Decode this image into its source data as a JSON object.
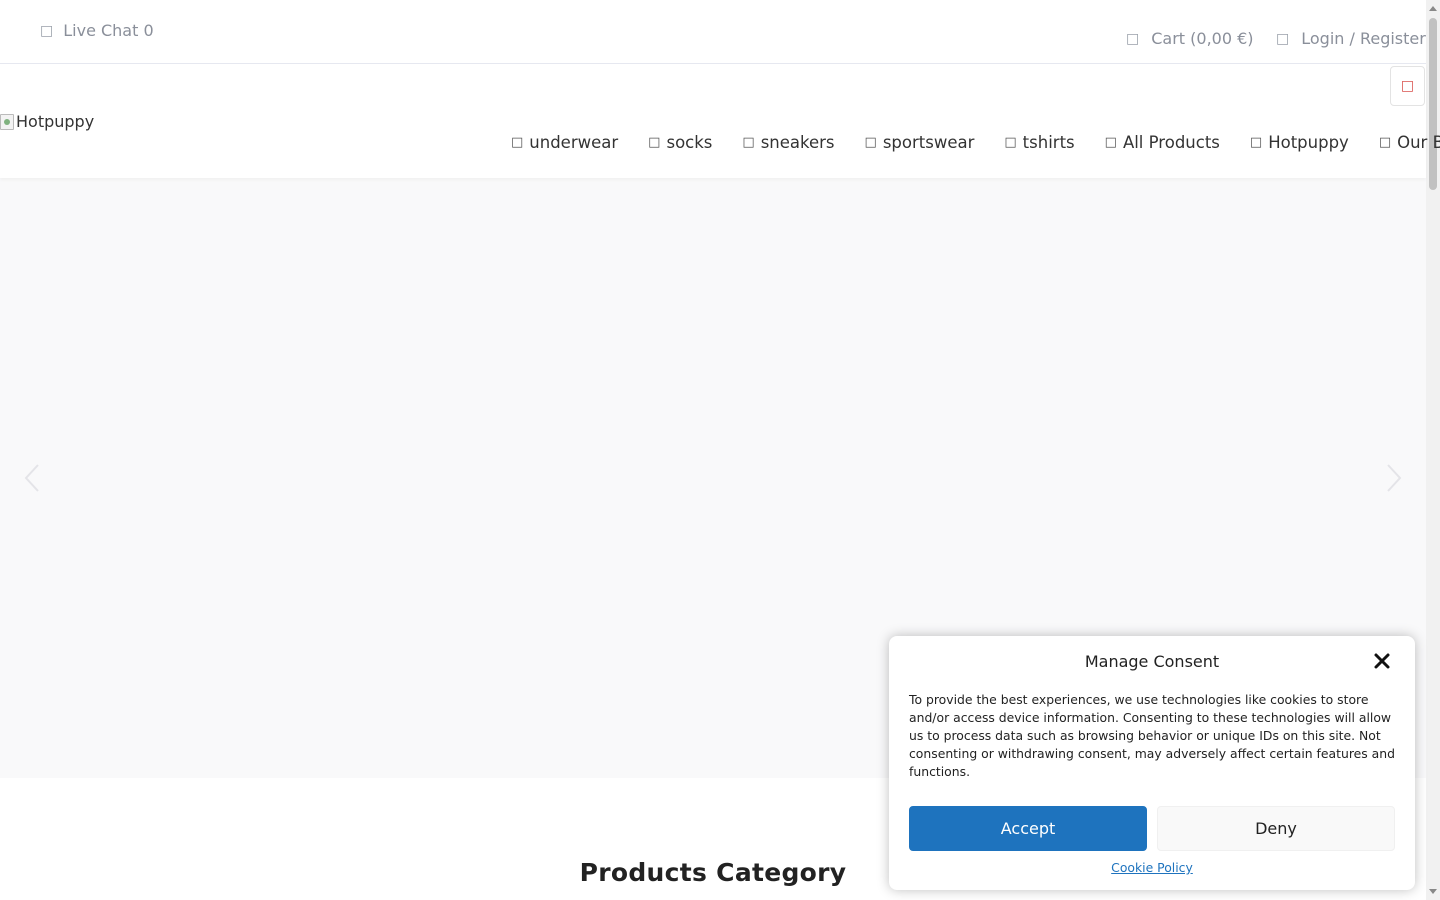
{
  "topbar": {
    "live_chat_icon": "chat-icon",
    "live_chat_label": "Live Chat 0",
    "cart_icon": "cart-icon",
    "cart_label": "Cart (0,00 €)",
    "login_icon": "user-icon",
    "login_label": "Login / Register"
  },
  "header": {
    "logo_alt": "Hotpuppy",
    "search_icon": "search-icon",
    "nav": [
      {
        "label": "underwear",
        "icon": "category-icon"
      },
      {
        "label": "socks",
        "icon": "category-icon"
      },
      {
        "label": "sneakers",
        "icon": "category-icon"
      },
      {
        "label": "sportswear",
        "icon": "category-icon"
      },
      {
        "label": "tshirts",
        "icon": "category-icon"
      },
      {
        "label": "All Products",
        "icon": "category-icon"
      },
      {
        "label": "Hotpuppy",
        "icon": "category-icon"
      },
      {
        "label": "Our Boys",
        "icon": "category-icon"
      }
    ]
  },
  "main": {
    "section_title": "Products Category"
  },
  "consent": {
    "title": "Manage Consent",
    "text": "To provide the best experiences, we use technologies like cookies to store and/or access device information. Consenting to these technologies will allow us to process data such as browsing behavior or unique IDs on this site. Not consenting or withdrawing consent, may adversely affect certain features and functions.",
    "accept_label": "Accept",
    "deny_label": "Deny",
    "policy_label": "Cookie Policy"
  },
  "colors": {
    "accent": "#1e73be",
    "search_icon": "#d9534f",
    "hero_bg": "#f9f9fa"
  }
}
